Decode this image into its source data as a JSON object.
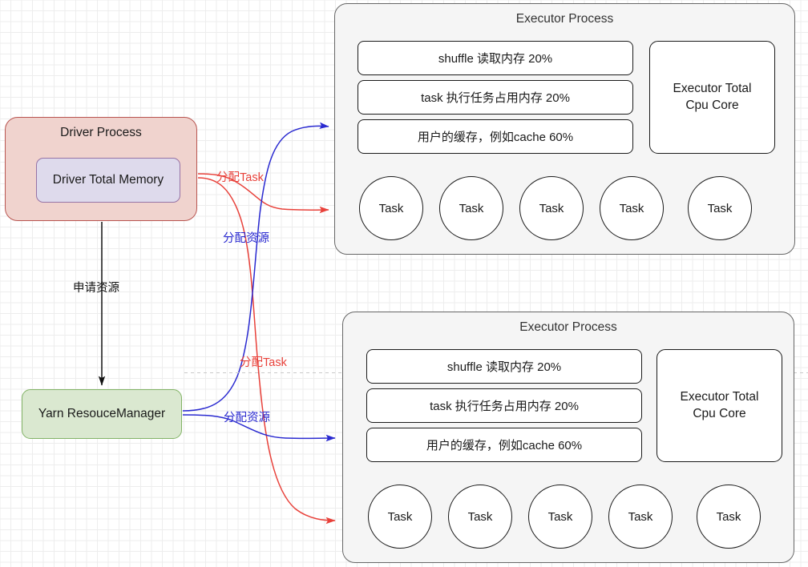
{
  "diagram": {
    "driver": {
      "title": "Driver Process",
      "memory_label": "Driver Total Memory"
    },
    "yarn": {
      "label": "Yarn ResouceManager"
    },
    "edges": {
      "apply_resource": "申请资源",
      "allocate_task_top": "分配Task",
      "allocate_resource_top": "分配资源",
      "allocate_task_bottom": "分配Task",
      "allocate_resource_bottom": "分配资源"
    },
    "executors": [
      {
        "title": "Executor Process",
        "memory_bars": [
          "shuffle 读取内存 20%",
          "task 执行任务占用内存 20%",
          "用户的缓存，例如cache 60%"
        ],
        "cpu_line1": "Executor Total",
        "cpu_line2": "Cpu Core",
        "tasks": [
          "Task",
          "Task",
          "Task",
          "Task",
          "Task"
        ]
      },
      {
        "title": "Executor Process",
        "memory_bars": [
          "shuffle 读取内存 20%",
          "task 执行任务占用内存 20%",
          "用户的缓存，例如cache 60%"
        ],
        "cpu_line1": "Executor Total",
        "cpu_line2": "Cpu Core",
        "tasks": [
          "Task",
          "Task",
          "Task",
          "Task",
          "Task"
        ]
      }
    ],
    "colors": {
      "driver_fill": "#f0d3ce",
      "driver_stroke": "#b85450",
      "memory_fill": "#dedaec",
      "memory_stroke": "#9673a6",
      "yarn_fill": "#dae8d0",
      "yarn_stroke": "#82b366",
      "executor_fill": "#f5f5f5",
      "executor_stroke": "#666666",
      "arrow_red": "#e8413a",
      "arrow_blue": "#2a2ad0",
      "arrow_black": "#111111"
    }
  }
}
